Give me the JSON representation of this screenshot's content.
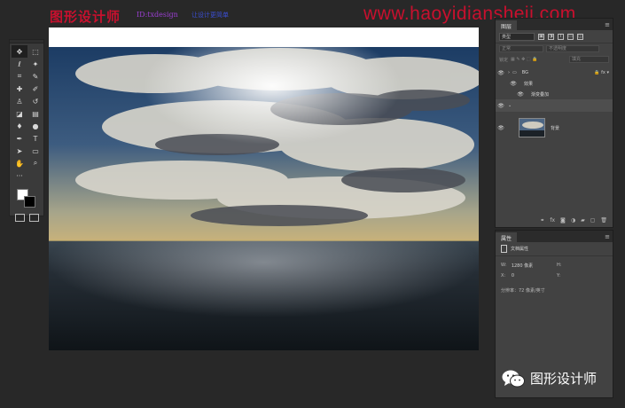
{
  "watermark": {
    "title": "图形设计师",
    "id": "ID:txdesign",
    "subtitle": "让设计更简单",
    "url": "www.haoyidiansheji.com",
    "brand_color": "#c8102e"
  },
  "tools": {
    "items": [
      "move-icon",
      "marquee-icon",
      "lasso-icon",
      "magic-wand-icon",
      "crop-icon",
      "eyedropper-icon",
      "healing-icon",
      "brush-icon",
      "stamp-icon",
      "history-brush-icon",
      "eraser-icon",
      "gradient-icon",
      "blur-icon",
      "dodge-icon",
      "pen-icon",
      "type-icon",
      "path-select-icon",
      "shape-icon",
      "hand-icon",
      "zoom-icon",
      "more-icon"
    ],
    "glyphs": {
      "move-icon": "✥",
      "marquee-icon": "⬚",
      "lasso-icon": "ℓ",
      "magic-wand-icon": "✦",
      "crop-icon": "⌗",
      "eyedropper-icon": "✎",
      "healing-icon": "✚",
      "brush-icon": "✐",
      "stamp-icon": "♙",
      "history-brush-icon": "↺",
      "eraser-icon": "◪",
      "gradient-icon": "▤",
      "blur-icon": "♦",
      "dodge-icon": "●",
      "pen-icon": "✒",
      "type-icon": "T",
      "path-select-icon": "➤",
      "shape-icon": "▭",
      "hand-icon": "✋",
      "zoom-icon": "⌕",
      "more-icon": "···"
    },
    "foreground_color": "#ffffff",
    "background_color": "#000000"
  },
  "layers_panel": {
    "tab": "图层",
    "filter_kind": "类型",
    "blend_mode": "正常",
    "opacity_label": "不透明度",
    "lock_label": "锁定",
    "fill_label": "填充",
    "layers": [
      {
        "name": "BG",
        "kind": "group",
        "visible": true
      },
      {
        "name": "效果",
        "kind": "effects",
        "visible": true
      },
      {
        "name": "渐变叠加",
        "kind": "effect-item",
        "visible": true
      },
      {
        "name": "",
        "kind": "selected-empty",
        "visible": true
      },
      {
        "name": "背景",
        "kind": "image",
        "visible": true
      }
    ],
    "footer_icons": [
      "link-icon",
      "fx-icon",
      "mask-icon",
      "adjustment-icon",
      "folder-icon",
      "new-layer-icon",
      "trash-icon"
    ],
    "footer_glyphs": [
      "⚭",
      "fx",
      "◙",
      "◑",
      "▰",
      "▢",
      "🗑"
    ]
  },
  "properties_panel": {
    "tab": "属性",
    "section": "文档属性",
    "width_label": "W:",
    "width_value": "1280 像素",
    "height_label": "H:",
    "height_value": "",
    "x_label": "X:",
    "x_value": "0",
    "y_label": "Y:",
    "y_value": "",
    "resolution": "分辨率：72 像素/英寸"
  },
  "wechat": {
    "label": "图形设计师",
    "icon": "wechat-icon"
  }
}
